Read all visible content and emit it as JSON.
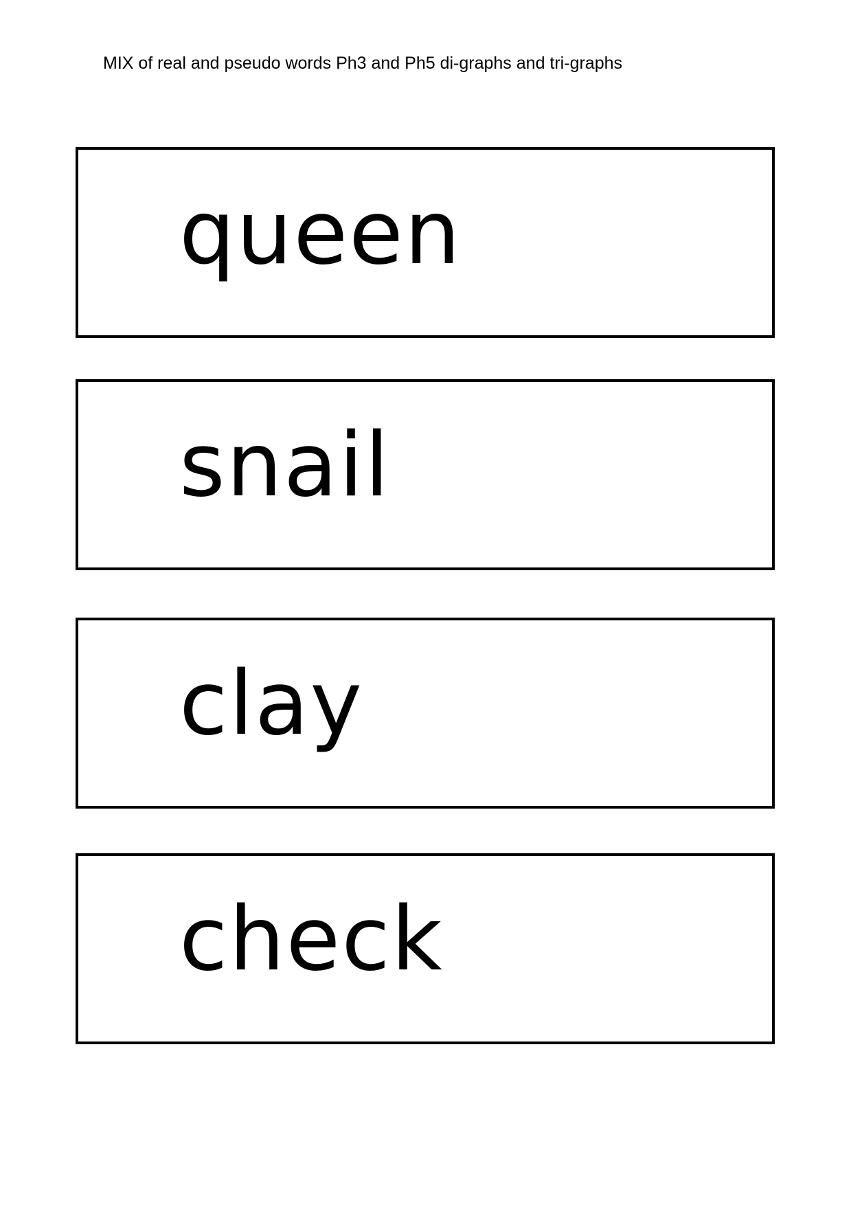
{
  "header": {
    "title": "MIX of real and pseudo words Ph3 and Ph5 di-graphs and tri-graphs"
  },
  "cards": [
    {
      "word": "queen"
    },
    {
      "word": "snail"
    },
    {
      "word": "clay"
    },
    {
      "word": "check"
    }
  ]
}
